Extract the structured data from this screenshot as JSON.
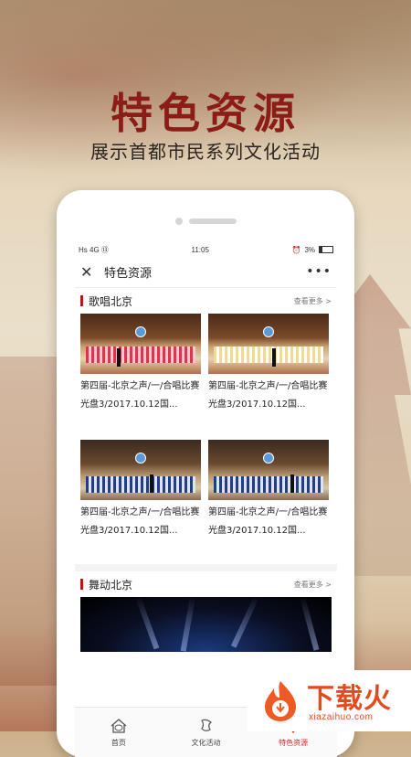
{
  "hero": {
    "title": "特色资源",
    "subtitle": "展示首都市民系列文化活动"
  },
  "status": {
    "left": "Hs 4G ⑬",
    "time": "11:05",
    "battery": "3%"
  },
  "navbar": {
    "title": "特色资源",
    "more": "•••"
  },
  "sections": [
    {
      "title": "歌唱北京",
      "more": "查看更多 >",
      "items": [
        {
          "caption": "第四届-北京之声/一/合唱比赛 光盘3/2017.10.12国..."
        },
        {
          "caption": "第四届-北京之声/一/合唱比赛 光盘3/2017.10.12国..."
        },
        {
          "caption": "第四届-北京之声/一/合唱比赛 光盘3/2017.10.12国..."
        },
        {
          "caption": "第四届-北京之声/一/合唱比赛 光盘3/2017.10.12国..."
        }
      ]
    },
    {
      "title": "舞动北京",
      "more": "查看更多 >"
    }
  ],
  "tabs": [
    {
      "label": "首页",
      "icon": "home-icon"
    },
    {
      "label": "文化活动",
      "icon": "culture-activity-icon"
    },
    {
      "label": "特色资源",
      "icon": "fan-icon"
    }
  ],
  "watermark": {
    "text": "下载火",
    "url": "xiazaihuo.com"
  },
  "colors": {
    "accent": "#b21a18",
    "hero_title": "#8b1d16",
    "watermark": "#e34a1e"
  }
}
